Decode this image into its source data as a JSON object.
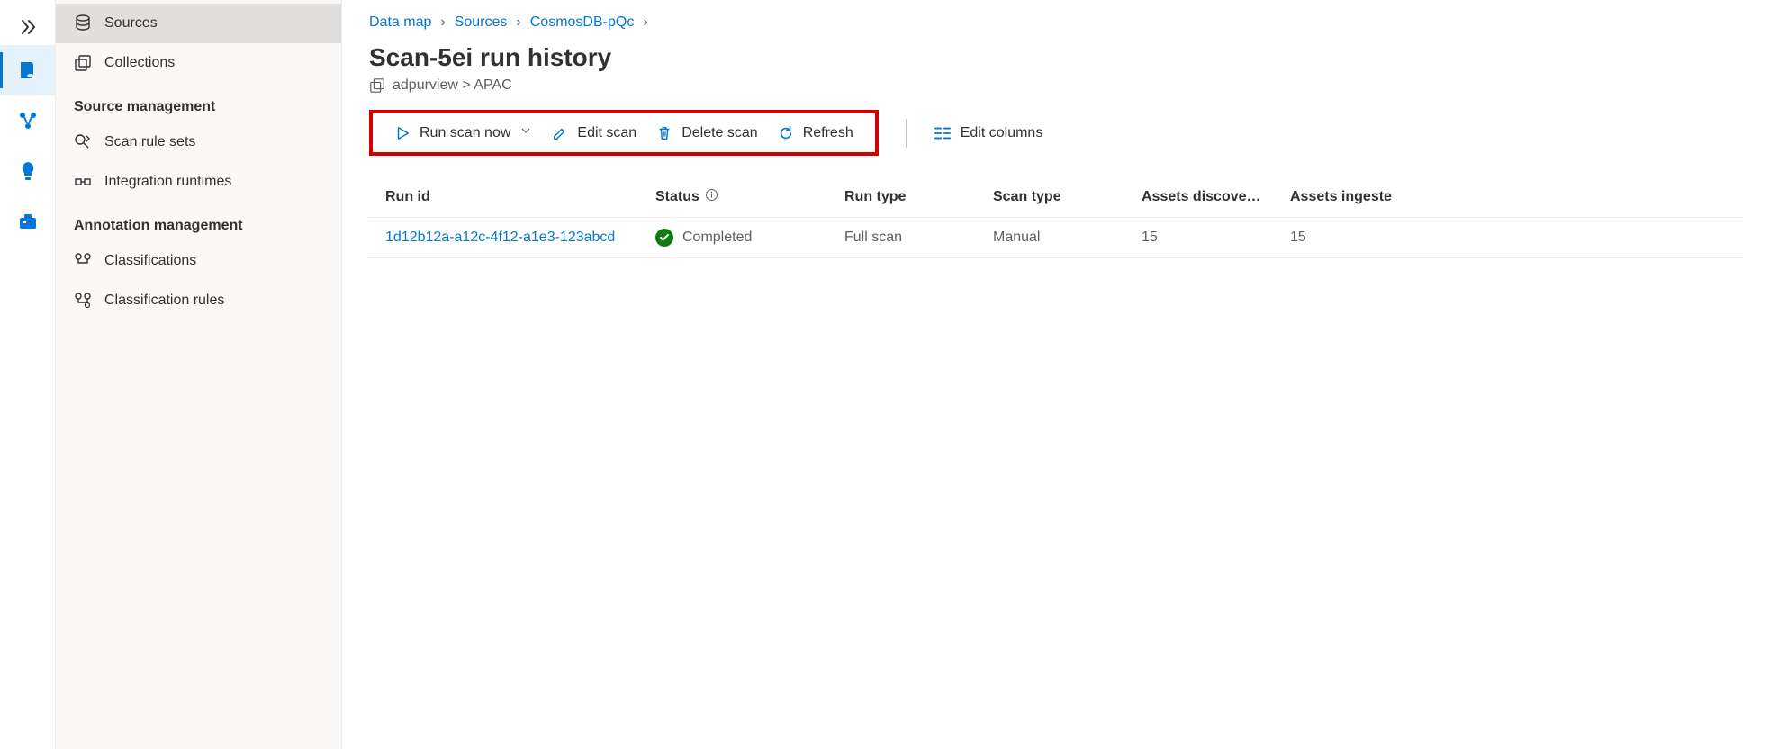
{
  "sidebar": {
    "items": [
      {
        "label": "Sources"
      },
      {
        "label": "Collections"
      }
    ],
    "heading1": "Source management",
    "source_mgmt": [
      {
        "label": "Scan rule sets"
      },
      {
        "label": "Integration runtimes"
      }
    ],
    "heading2": "Annotation management",
    "annotation_mgmt": [
      {
        "label": "Classifications"
      },
      {
        "label": "Classification rules"
      }
    ]
  },
  "breadcrumb": {
    "items": [
      "Data map",
      "Sources",
      "CosmosDB-pQc"
    ]
  },
  "page": {
    "title": "Scan-5ei run history",
    "subtitle": "adpurview > APAC"
  },
  "commands": {
    "run_scan": "Run scan now",
    "edit_scan": "Edit scan",
    "delete_scan": "Delete scan",
    "refresh": "Refresh",
    "edit_columns": "Edit columns"
  },
  "table": {
    "columns": [
      "Run id",
      "Status",
      "Run type",
      "Scan type",
      "Assets discove…",
      "Assets ingeste"
    ],
    "rows": [
      {
        "run_id": "1d12b12a-a12c-4f12-a1e3-123abcd",
        "status": "Completed",
        "run_type": "Full scan",
        "scan_type": "Manual",
        "assets_discovered": "15",
        "assets_ingested": "15"
      }
    ]
  }
}
